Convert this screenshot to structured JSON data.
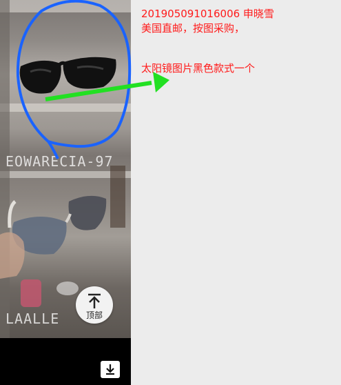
{
  "photo": {
    "watermark_top": "EOWARECIA-97",
    "watermark_bottom": "LAALLE"
  },
  "buttons": {
    "scroll_top_label": "顶部",
    "scroll_top_icon": "arrow-up-to-line-icon",
    "download_icon": "download-icon"
  },
  "annotation": {
    "line1": "201905091016006   申晓雪",
    "line2": "美国直邮，按图采购，",
    "line3": "太阳镜图片黑色款式一个",
    "color": "#ff1a1a"
  },
  "markers": {
    "circle_color": "#1a63ff",
    "arrow_color": "#22e022"
  }
}
